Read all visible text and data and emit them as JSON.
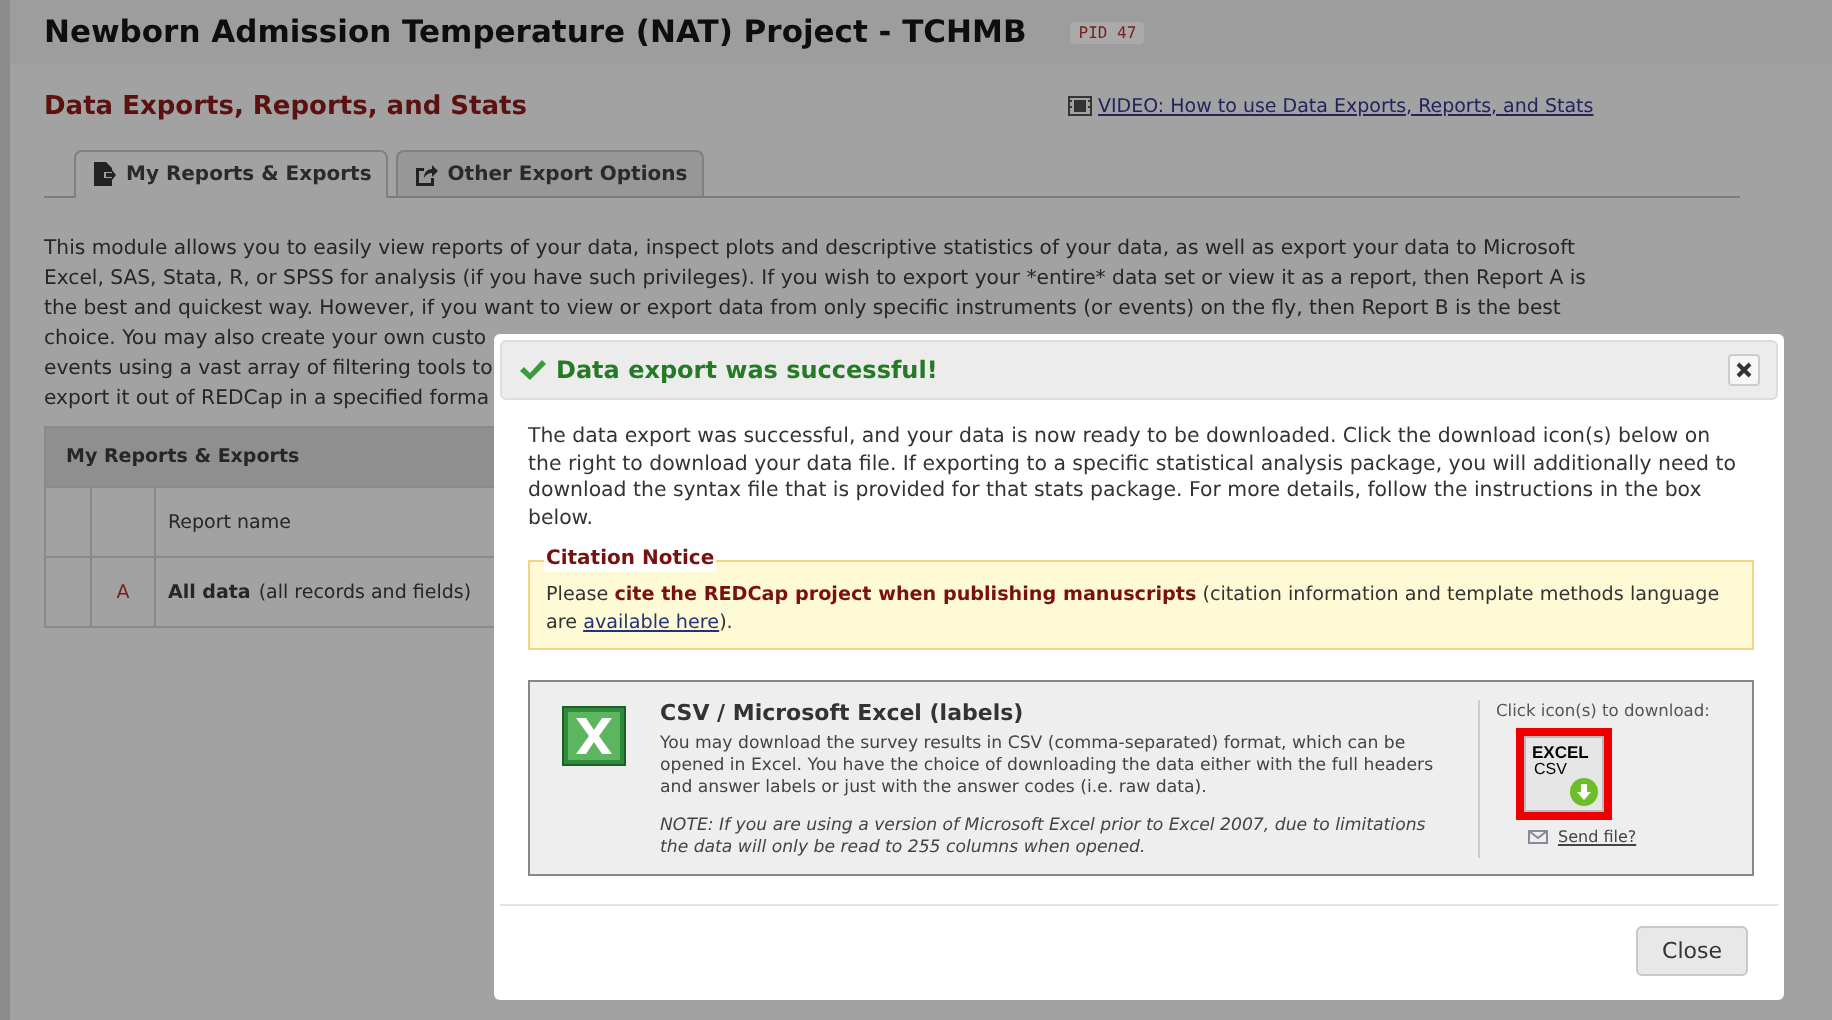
{
  "project": {
    "title": "Newborn Admission Temperature (NAT) Project - TCHMB",
    "pid": "PID 47"
  },
  "page": {
    "heading": "Data Exports, Reports, and Stats",
    "video_link": "VIDEO: How to use Data Exports, Reports, and Stats"
  },
  "tabs": [
    {
      "label": "My Reports & Exports",
      "selected": true
    },
    {
      "label": "Other Export Options",
      "selected": false
    }
  ],
  "intro_lines": [
    "This module allows you to easily view reports of your data, inspect plots and descriptive statistics of your data, as well as export your data to Microsoft",
    "Excel, SAS, Stata, R, or SPSS for analysis (if you have such privileges). If you wish to export your *entire* data set or view it as a report, then Report A is",
    "the best and quickest way. However, if you want to view or export data from only specific instruments (or events) on the fly, then Report B is the best",
    "choice. You may also create your own custo",
    "events using a vast array of filtering tools to",
    "export it out of REDCap in a specified forma"
  ],
  "reports_table": {
    "title": "My Reports & Exports",
    "columns": [
      "Report name"
    ],
    "rows": [
      {
        "letter": "A",
        "name": "All data",
        "detail": "(all records and fields)"
      }
    ]
  },
  "dialog": {
    "title": "Data export was successful!",
    "message": "The data export was successful, and your data is now ready to be downloaded. Click the download icon(s) below on the right to download your data file. If exporting to a specific statistical analysis package, you will additionally need to download the syntax file that is provided for that stats package. For more details, follow the instructions in the box below.",
    "citation": {
      "legend": "Citation Notice",
      "text": "Please **cite the REDCap project when publishing manuscripts** (citation information and template methods language are ",
      "link": "available here",
      "end": ")."
    },
    "export": {
      "title": "CSV / Microsoft Excel (labels)",
      "description": "You may download the survey results in CSV (comma-separated) format, which can be opened in Excel. You have the choice of downloading the data either with the full headers and answer labels or just with the answer codes (i.e. raw data).",
      "note": "NOTE: If you are using a version of Microsoft Excel prior to Excel 2007, due to limitations the data will only be read to 255 columns when opened.",
      "download_hint": "Click icon(s) to download:",
      "file_icon_label": [
        "EXCEL",
        "CSV"
      ],
      "highlighted": true,
      "send_link": "Send file?"
    },
    "close_button": "Close"
  }
}
